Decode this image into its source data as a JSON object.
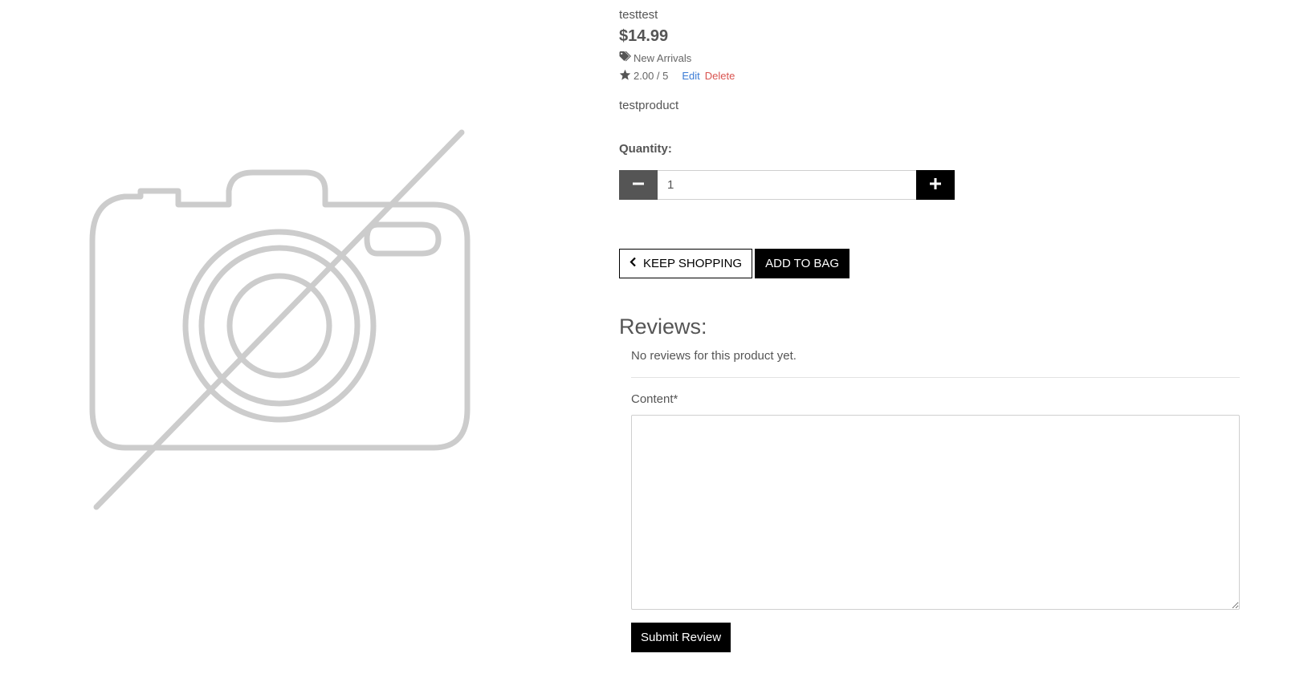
{
  "product": {
    "name": "testtest",
    "price": "$14.99",
    "category": "New Arrivals",
    "rating": "2.00 / 5",
    "edit_label": "Edit",
    "delete_label": "Delete",
    "description": "testproduct"
  },
  "quantity": {
    "label": "Quantity:",
    "value": "1"
  },
  "actions": {
    "keep_shopping_label": "Keep Shopping",
    "add_to_bag_label": "Add to Bag"
  },
  "reviews": {
    "heading": "Reviews:",
    "empty_text": "No reviews for this product yet.",
    "content_label": "Content*",
    "submit_label": "Submit Review"
  },
  "colors": {
    "edit_link": "#3a7bd5",
    "delete_link": "#d9534f",
    "button_dark": "#000000",
    "minus_button": "#555555"
  },
  "icons": {
    "image": "no-image-camera-icon",
    "category": "tag-icon",
    "rating": "star-icon",
    "minus": "minus-icon",
    "plus": "plus-icon",
    "back": "chevron-left-icon"
  }
}
